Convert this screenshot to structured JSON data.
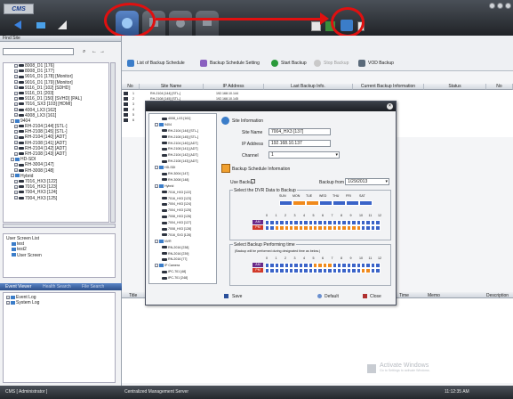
{
  "app": {
    "logo": "CMS"
  },
  "colors": {
    "accent": "#2e6bd2",
    "annotation_red": "#e01010",
    "orange": "#f08a1c",
    "blue_cell": "#3a63c8",
    "red_cell": "#d23a2a"
  },
  "left": {
    "find_site_label": "Find Site",
    "tree": [
      "8008_D1 [176]",
      "8008_D1 [177]",
      "9016_D1 [178] [Monitor]",
      "9016_D1 [179] [Monitor]",
      "9116_D1 [102] [SDHD]",
      "9116_D1 [203]",
      "9116_D1 [150] [SVHD] [PAL]",
      "7016_SX3 [103] [HDMI]",
      "4004_LX3 [162]",
      "4008_LX3 [161]",
      "9404",
      "RH-2104 [144] [STL-]",
      "RH-2108 [145] [STL-]",
      "RH-2104 [140] [ADT]",
      "RH-2108 [141] [ADT]",
      "RH-2104 [142] [ADT]",
      "RH-2108 [143] [ADT]",
      "HD-SDI",
      "RH-3004 [147]",
      "RH-3008 [148]",
      "Hybrid",
      "7016_HX3 [122]",
      "7016_HX3 [123]",
      "7004_HX3 [124]",
      "7004_HX3 [125]"
    ],
    "user_screen_list_label": "User Screen List",
    "user_screens": [
      "test",
      "test2",
      "User Screen"
    ],
    "event_tabs": [
      "Event Viewer",
      "Health Search",
      "File Search"
    ],
    "events": [
      "Event Log",
      "System Log"
    ]
  },
  "toolbar": {
    "list_label": "List of Backup Schedule",
    "setting_label": "Backup Schedule Setting",
    "start_label": "Start Backup",
    "stop_label": "Stop Backup",
    "vod_label": "VOD Backup"
  },
  "table": {
    "headers": [
      "No",
      "Site Name",
      "IP Address",
      "Last Backup Info.",
      "Current Backup Information",
      "Status",
      "No"
    ],
    "rows": [
      {
        "no": "1",
        "site": "RH-2104 [144] [STL-]",
        "ip": "192.168.10.144"
      },
      {
        "no": "2",
        "site": "RH-2108 [145] [STL-]",
        "ip": "192.168.10.145"
      },
      {
        "no": "3",
        "site": "",
        "ip": ""
      },
      {
        "no": "4",
        "site": "",
        "ip": ""
      },
      {
        "no": "5",
        "site": "",
        "ip": ""
      },
      {
        "no": "6",
        "site": "",
        "ip": ""
      }
    ]
  },
  "dialog": {
    "tree": [
      "4008_LX3 [161]",
      "9404",
      "RH-2104 [144] [STL-]",
      "RH-2108 [145] [STL-]",
      "RH-2104 [140] [ADT]",
      "RH-2108 [141] [ADT]",
      "RH-2104 [142] [ADT]",
      "RH-2108 [143] [ADT]",
      "HD-SDI",
      "RH-3004 [147]",
      "RH-3008 [148]",
      "Hybrid",
      "7016_HX3 [122]",
      "7016_HX3 [123]",
      "7004_HX3 [124]",
      "7004_HX3 [125]",
      "7008_HX3 [126]",
      "7004_HX3 [127]",
      "7008_HX3 [128]",
      "7016_SX3 [128]",
      "NVR",
      "RN-2016 [238]",
      "RN-2016 [239]",
      "RN-2016 [77]",
      "IP Camera",
      "IPC-701 [48]",
      "IPC-701 [248]"
    ],
    "site_info_label": "Site Information",
    "site_name_label": "Site Name",
    "site_name_value": "7004_HX3 [137]",
    "ip_label": "IP Address",
    "ip_value": "192.168.10.137",
    "channel_label": "Channel",
    "channel_value": "1",
    "schedule_label": "Backup Schedule Information",
    "use_backup_label": "Use Backup",
    "backup_from_label": "Backup from",
    "backup_from_value": "1/29/2013",
    "select_dvr_label": "Select the DVR Data to Backup",
    "days": [
      "SUN",
      "MON",
      "TUE",
      "WED",
      "THU",
      "FRI",
      "SAT"
    ],
    "hours": [
      "0",
      "1",
      "2",
      "3",
      "4",
      "5",
      "6",
      "7",
      "8",
      "9",
      "10",
      "11",
      "12"
    ],
    "am": "AM",
    "pm": "PM",
    "select_time_label": "Select Backup Performing time",
    "select_time_note": "(Backup will be performed during designated time as below.)",
    "save_label": "Save",
    "default_label": "Default",
    "close_label": "Close"
  },
  "bottom_table_headers": [
    "Title",
    "Time",
    "Memo",
    "Description"
  ],
  "watermark": {
    "line1": "Activate Windows",
    "line2": "Go to Settings to activate Windows."
  },
  "status": {
    "user": "CMS [ Administrator ]",
    "server": "Centralized Management Server",
    "time": "11:12:35 AM"
  }
}
